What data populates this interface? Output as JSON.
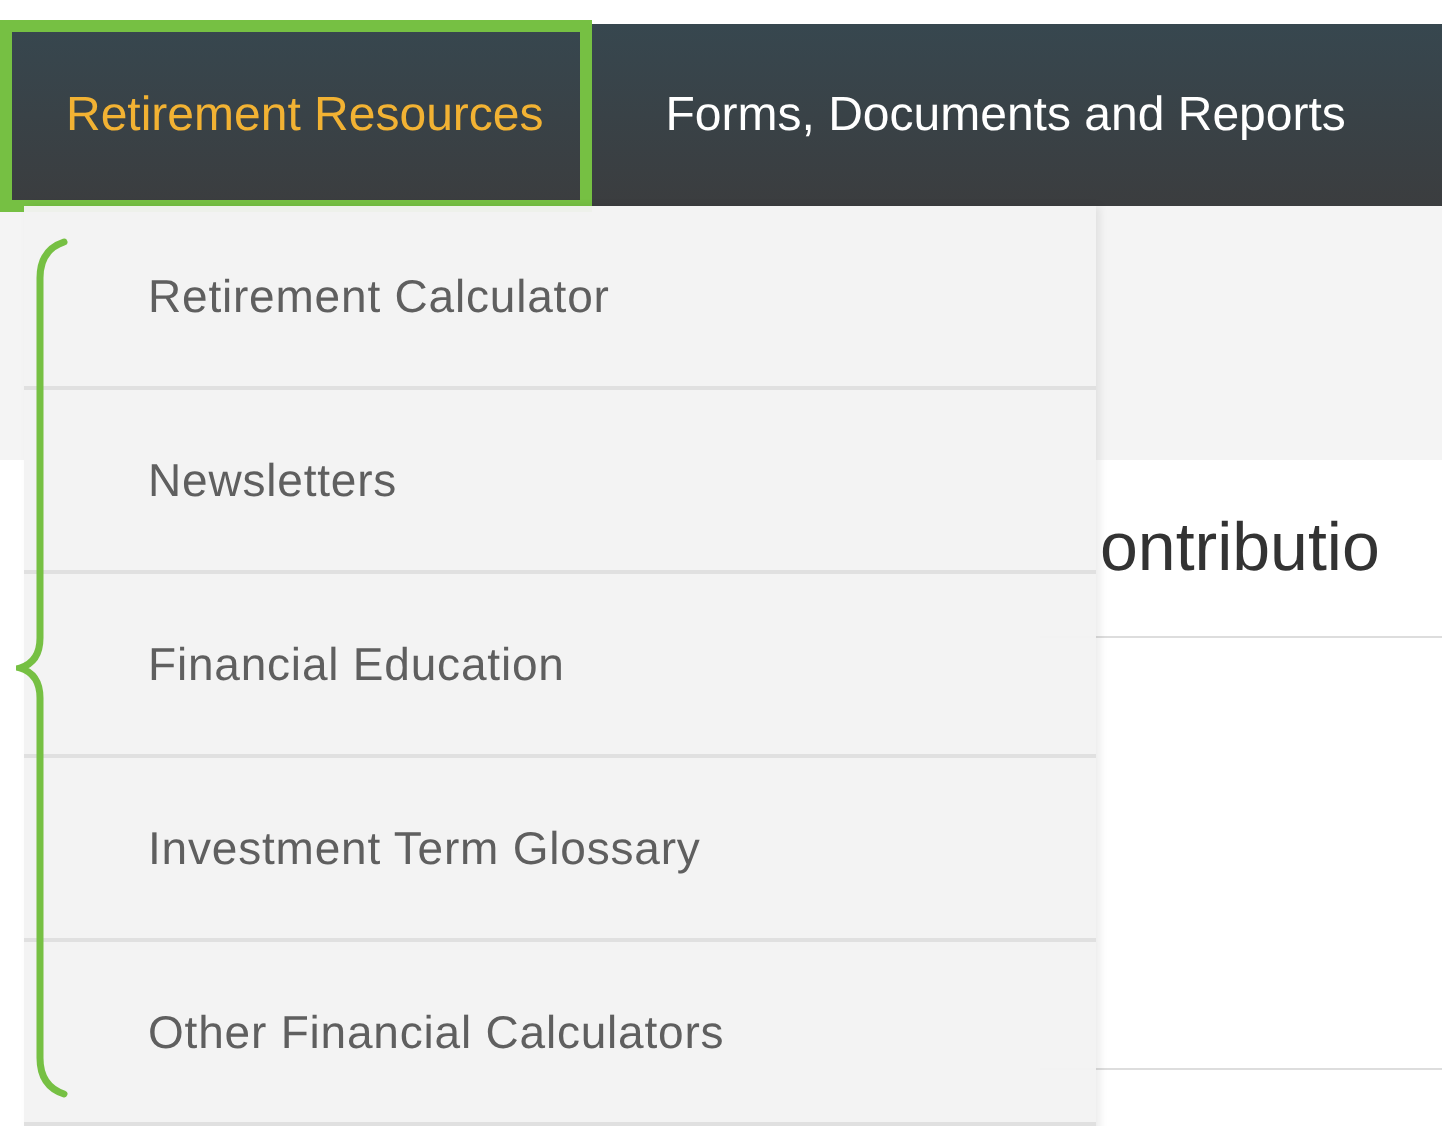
{
  "nav": {
    "tabs": [
      {
        "label": "Retirement Resources",
        "selected": true,
        "highlighted": true
      },
      {
        "label": "Forms, Documents and Reports",
        "selected": false,
        "highlighted": false
      }
    ]
  },
  "dropdown": {
    "bracketed": true,
    "items": [
      {
        "label": "Retirement Calculator"
      },
      {
        "label": "Newsletters"
      },
      {
        "label": "Financial Education"
      },
      {
        "label": "Investment Term Glossary"
      },
      {
        "label": "Other Financial Calculators"
      }
    ]
  },
  "contribution_card": {
    "title": "ontributio"
  }
}
